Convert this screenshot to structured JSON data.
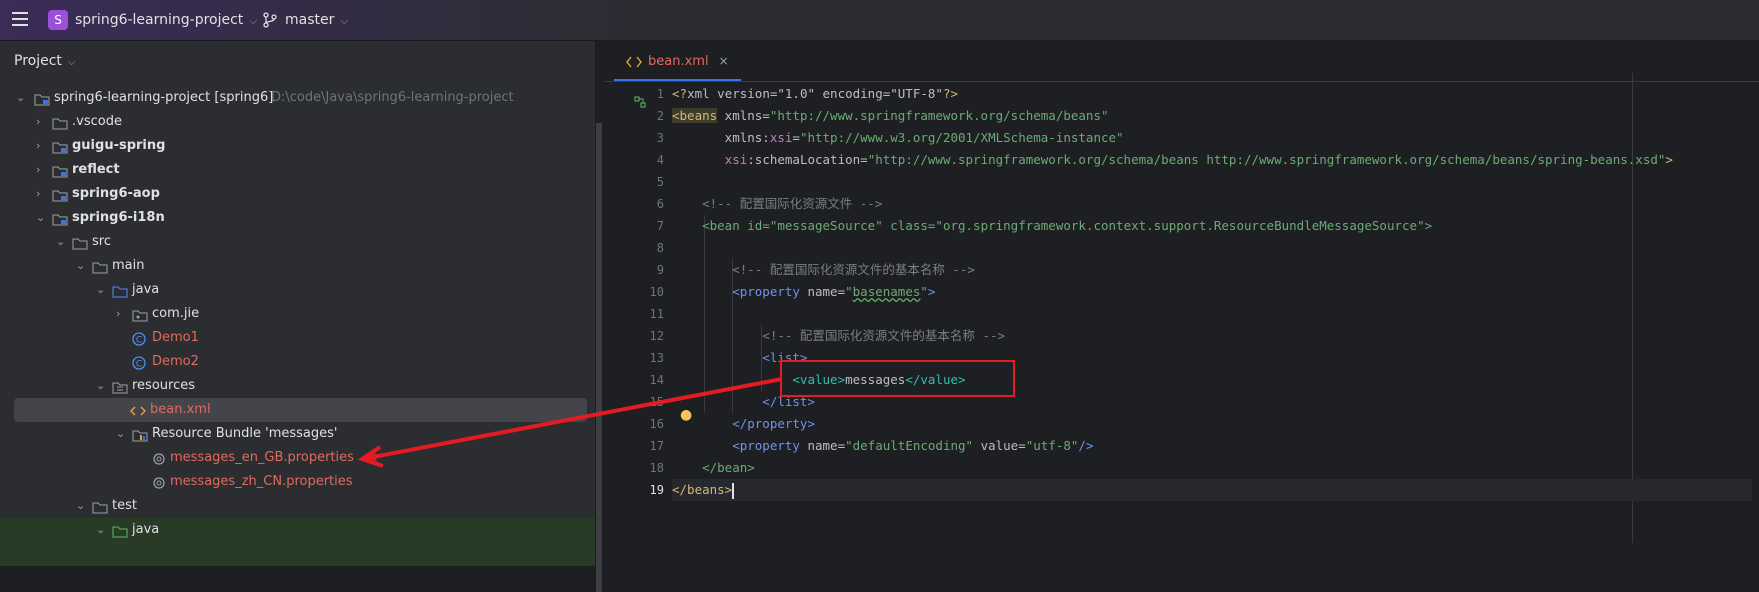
{
  "topbar": {
    "project_badge": "S",
    "project_name": "spring6-learning-project",
    "branch": "master"
  },
  "project_panel": {
    "title": "Project",
    "tree": [
      {
        "label": "spring6-learning-project [spring6]",
        "path": "D:\\code\\Java\\spring6-learning-project",
        "icon": "module-folder-icon",
        "expanded": true,
        "style": "normal"
      },
      {
        "label": ".vscode",
        "icon": "folder-icon",
        "style": "normal"
      },
      {
        "label": "guigu-spring",
        "icon": "module-folder-icon",
        "style": "bold"
      },
      {
        "label": "reflect",
        "icon": "module-folder-icon",
        "style": "bold"
      },
      {
        "label": "spring6-aop",
        "icon": "module-folder-icon",
        "style": "bold"
      },
      {
        "label": "spring6-i18n",
        "icon": "module-folder-icon",
        "style": "bold"
      },
      {
        "label": "src",
        "icon": "folder-icon",
        "style": "normal"
      },
      {
        "label": "main",
        "icon": "folder-icon",
        "style": "normal"
      },
      {
        "label": "java",
        "icon": "source-folder-icon",
        "style": "normal"
      },
      {
        "label": "com.jie",
        "icon": "package-icon",
        "style": "normal"
      },
      {
        "label": "Demo1",
        "icon": "class-icon",
        "style": "red"
      },
      {
        "label": "Demo2",
        "icon": "class-icon",
        "style": "red"
      },
      {
        "label": "resources",
        "icon": "resources-folder-icon",
        "style": "normal"
      },
      {
        "label": "bean.xml",
        "icon": "xml-file-icon",
        "style": "red"
      },
      {
        "label": "Resource Bundle 'messages'",
        "icon": "resource-bundle-icon",
        "style": "normal"
      },
      {
        "label": "messages_en_GB.properties",
        "icon": "properties-file-icon",
        "style": "red"
      },
      {
        "label": "messages_zh_CN.properties",
        "icon": "properties-file-icon",
        "style": "red"
      },
      {
        "label": "test",
        "icon": "folder-icon",
        "style": "normal"
      },
      {
        "label": "java",
        "icon": "test-folder-icon",
        "style": "normal"
      }
    ]
  },
  "editor": {
    "tab": {
      "label": "bean.xml",
      "close": "×"
    },
    "line_numbers": [
      "1",
      "2",
      "3",
      "4",
      "5",
      "6",
      "7",
      "8",
      "9",
      "10",
      "11",
      "12",
      "13",
      "14",
      "15",
      "16",
      "17",
      "18",
      "19"
    ],
    "lines": {
      "l1": {
        "a": "<?",
        "b": "xml version=\"1.0\" encoding=\"UTF-8\"",
        "c": "?>"
      },
      "l2": {
        "a": "<beans",
        "b": " xmlns=",
        "c": "\"http://www.springframework.org/schema/beans\""
      },
      "l3": {
        "a": "       xmlns:",
        "b": "xsi",
        "c": "=",
        "d": "\"http://www.w3.org/2001/XMLSchema-instance\""
      },
      "l4": {
        "a": "       ",
        "b": "xsi",
        "c": ":schemaLocation=",
        "d": "\"http://www.springframework.org/schema/beans http://www.springframework.org/schema/beans/spring-beans.xsd\"",
        "e": ">"
      },
      "l6": {
        "a": "    <!-- 配置国际化资源文件 -->"
      },
      "l7": {
        "a": "    <bean ",
        "b": "id=",
        "c": "\"messageSource\"",
        "d": " class=",
        "e": "\"org.springframework.context.support.ResourceBundleMessageSource\"",
        "f": ">"
      },
      "l9": {
        "a": "        <!-- 配置国际化资源文件的基本名称 -->"
      },
      "l10": {
        "a": "        <property ",
        "b": "name=",
        "c": "\"",
        "d": "basenames",
        "e": "\"",
        "f": ">"
      },
      "l12": {
        "a": "            <!-- 配置国际化资源文件的基本名称 -->"
      },
      "l13": {
        "a": "            <list>"
      },
      "l14": {
        "a": "                <value>",
        "b": "messages",
        "c": "</value>"
      },
      "l15": {
        "a": "            </list>"
      },
      "l16": {
        "a": "        </property>"
      },
      "l17": {
        "a": "        <property ",
        "b": "name=",
        "c": "\"defaultEncoding\"",
        "d": " value=",
        "e": "\"utf-8\"",
        "f": "/>"
      },
      "l18": {
        "a": "    </bean>"
      },
      "l19": {
        "a": "</beans>"
      }
    }
  },
  "colors": {
    "accent": "#3574f0",
    "annotation": "#e31c23",
    "project_badge": "#9c4fd9"
  }
}
